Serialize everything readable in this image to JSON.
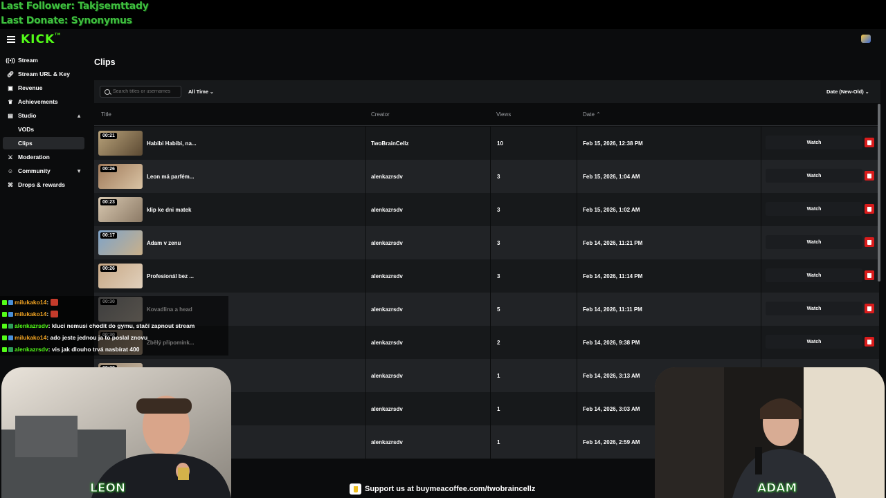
{
  "overlay": {
    "last_follower": "Last Follower: Takjsemttady",
    "last_donate": "Last Donate: Synonymus"
  },
  "app": {
    "logo": "KICK"
  },
  "sidebar": {
    "items": [
      {
        "label": "Stream",
        "icon": "broadcast-icon"
      },
      {
        "label": "Stream URL & Key",
        "icon": "link-icon"
      },
      {
        "label": "Revenue",
        "icon": "dollar-icon"
      },
      {
        "label": "Achievements",
        "icon": "trophy-icon"
      },
      {
        "label": "Studio",
        "icon": "studio-icon"
      },
      {
        "label": "VODs"
      },
      {
        "label": "Clips"
      },
      {
        "label": "Moderation",
        "icon": "sword-icon"
      },
      {
        "label": "Community",
        "icon": "community-icon"
      },
      {
        "label": "Drops & rewards",
        "icon": "gift-icon"
      }
    ]
  },
  "page": {
    "title": "Clips"
  },
  "filters": {
    "search_placeholder": "Search titles or usernames",
    "time_range": "All Time",
    "sort": "Date (New-Old)"
  },
  "table": {
    "columns": [
      "Title",
      "Creator",
      "Views",
      "Date"
    ],
    "watch_label": "Watch",
    "rows": [
      {
        "duration": "00:21",
        "title": "Habibi Habibi, na...",
        "creator": "TwoBrainCellz",
        "views": "10",
        "date": "Feb 15, 2026, 12:38 PM"
      },
      {
        "duration": "00:26",
        "title": "Leon má parfém...",
        "creator": "alenkazrsdv",
        "views": "3",
        "date": "Feb 15, 2026, 1:04 AM"
      },
      {
        "duration": "00:23",
        "title": "klip ke dni matek",
        "creator": "alenkazrsdv",
        "views": "3",
        "date": "Feb 15, 2026, 1:02 AM"
      },
      {
        "duration": "00:17",
        "title": "Adam v zenu",
        "creator": "alenkazrsdv",
        "views": "3",
        "date": "Feb 14, 2026, 11:21 PM"
      },
      {
        "duration": "00:26",
        "title": "Profesionál bez ...",
        "creator": "alenkazrsdv",
        "views": "3",
        "date": "Feb 14, 2026, 11:14 PM"
      },
      {
        "duration": "00:30",
        "title": "Kovadlina a head",
        "creator": "alenkazrsdv",
        "views": "5",
        "date": "Feb 14, 2026, 11:11 PM"
      },
      {
        "duration": "00:30",
        "title": "Zbělý připomínk...",
        "creator": "alenkazrsdv",
        "views": "2",
        "date": "Feb 14, 2026, 9:38 PM"
      },
      {
        "duration": "00:30",
        "title": "",
        "creator": "alenkazrsdv",
        "views": "1",
        "date": "Feb 14, 2026, 3:13 AM"
      },
      {
        "duration": "",
        "title": "",
        "creator": "alenkazrsdv",
        "views": "1",
        "date": "Feb 14, 2026, 3:03 AM"
      },
      {
        "duration": "",
        "title": "",
        "creator": "alenkazrsdv",
        "views": "1",
        "date": "Feb 14, 2026, 2:59 AM"
      }
    ]
  },
  "chat": [
    {
      "user": "milukako14",
      "text": " :",
      "color": "#f5a623",
      "emote": true
    },
    {
      "user": "milukako14",
      "text": " :",
      "color": "#f5a623",
      "emote": true
    },
    {
      "user": "alenkazrsdv",
      "text": " : kluci nemusi chodit do gymu, stačí zapnout stream",
      "color": "#53fc18",
      "emote": false
    },
    {
      "user": "milukako14",
      "text": " : ado jeste jednou ja to poslal znovu",
      "color": "#f5a623",
      "emote": false
    },
    {
      "user": "alenkazrsdv",
      "text": " : vis jak dlouho trvá nasbírat 400",
      "color": "#53fc18",
      "emote": false
    }
  ],
  "cams": {
    "left_name": "LEON",
    "right_name": "ADAM"
  },
  "support": {
    "text": "Support us at buymeacoffee.com/twobraincellz"
  },
  "colors": {
    "accent": "#53fc18",
    "delete": "#d91c1c",
    "overlay_text": "#3fbf3f"
  }
}
